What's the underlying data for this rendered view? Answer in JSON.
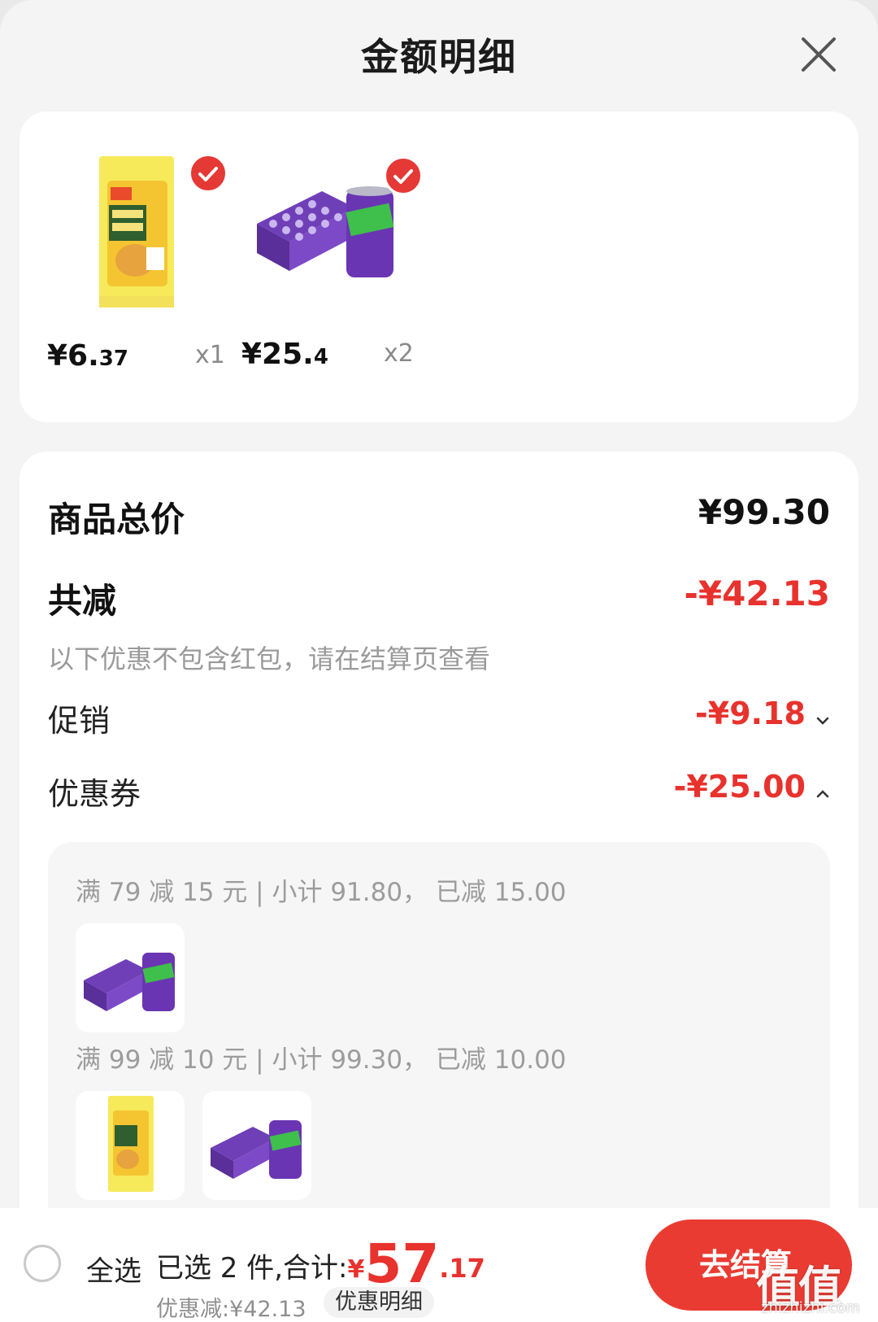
{
  "header": {
    "title": "金额明细"
  },
  "products": [
    {
      "price_int": "¥6.",
      "price_dec": "37",
      "qty": "x1",
      "checked": true
    },
    {
      "price_int": "¥25.",
      "price_dec": "4",
      "qty": "x2",
      "checked": true
    }
  ],
  "summary": {
    "total_label": "商品总价",
    "total_value": "¥99.30",
    "reduce_label": "共减",
    "reduce_value": "-¥42.13",
    "note": "以下优惠不包含红包，请在结算页查看",
    "promo_label": "促销",
    "promo_value": "-¥9.18",
    "coupon_label": "优惠券",
    "coupon_value": "-¥25.00"
  },
  "coupons": [
    {
      "line": "满 79 减 15 元 | 小计 91.80， 已减 15.00"
    },
    {
      "line": "满 99 减 10 元 | 小计 99.30， 已减 10.00"
    }
  ],
  "bottom": {
    "select_all": "全选",
    "selected_text": "已选 2 件,合计:",
    "currency": "¥",
    "total_int": "57",
    "total_dec": ".17",
    "discount_text": "优惠减:¥42.13",
    "detail_chip": "优惠明细",
    "checkout": "去结算"
  },
  "watermark": {
    "main": "值值值",
    "sub": "zhizhizhi.com"
  }
}
